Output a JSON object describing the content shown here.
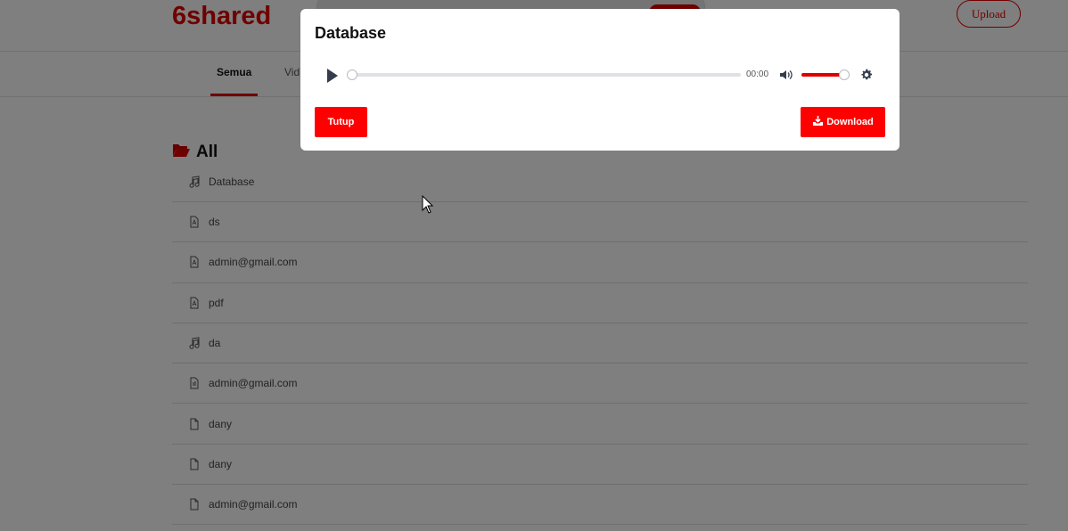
{
  "header": {
    "brand": "6shared",
    "upload_label": "Upload"
  },
  "tabs": [
    {
      "label": "Semua",
      "active": true
    },
    {
      "label": "Vid",
      "active": false
    }
  ],
  "section": {
    "title": "All"
  },
  "files": [
    {
      "name": "Database",
      "icon": "music-icon"
    },
    {
      "name": "ds",
      "icon": "pdf-file-icon"
    },
    {
      "name": "admin@gmail.com",
      "icon": "pdf-file-icon"
    },
    {
      "name": "pdf",
      "icon": "pdf-file-icon"
    },
    {
      "name": "da",
      "icon": "music-icon"
    },
    {
      "name": "admin@gmail.com",
      "icon": "audio-file-icon"
    },
    {
      "name": "dany",
      "icon": "file-icon"
    },
    {
      "name": "dany",
      "icon": "file-icon"
    },
    {
      "name": "admin@gmail.com",
      "icon": "file-icon"
    }
  ],
  "modal": {
    "title": "Database",
    "player": {
      "time": "00:00",
      "progress": 0,
      "volume": 1.0
    },
    "close_label": "Tutup",
    "download_label": "Download"
  },
  "colors": {
    "accent": "#ff0000",
    "brand": "#e00000"
  }
}
